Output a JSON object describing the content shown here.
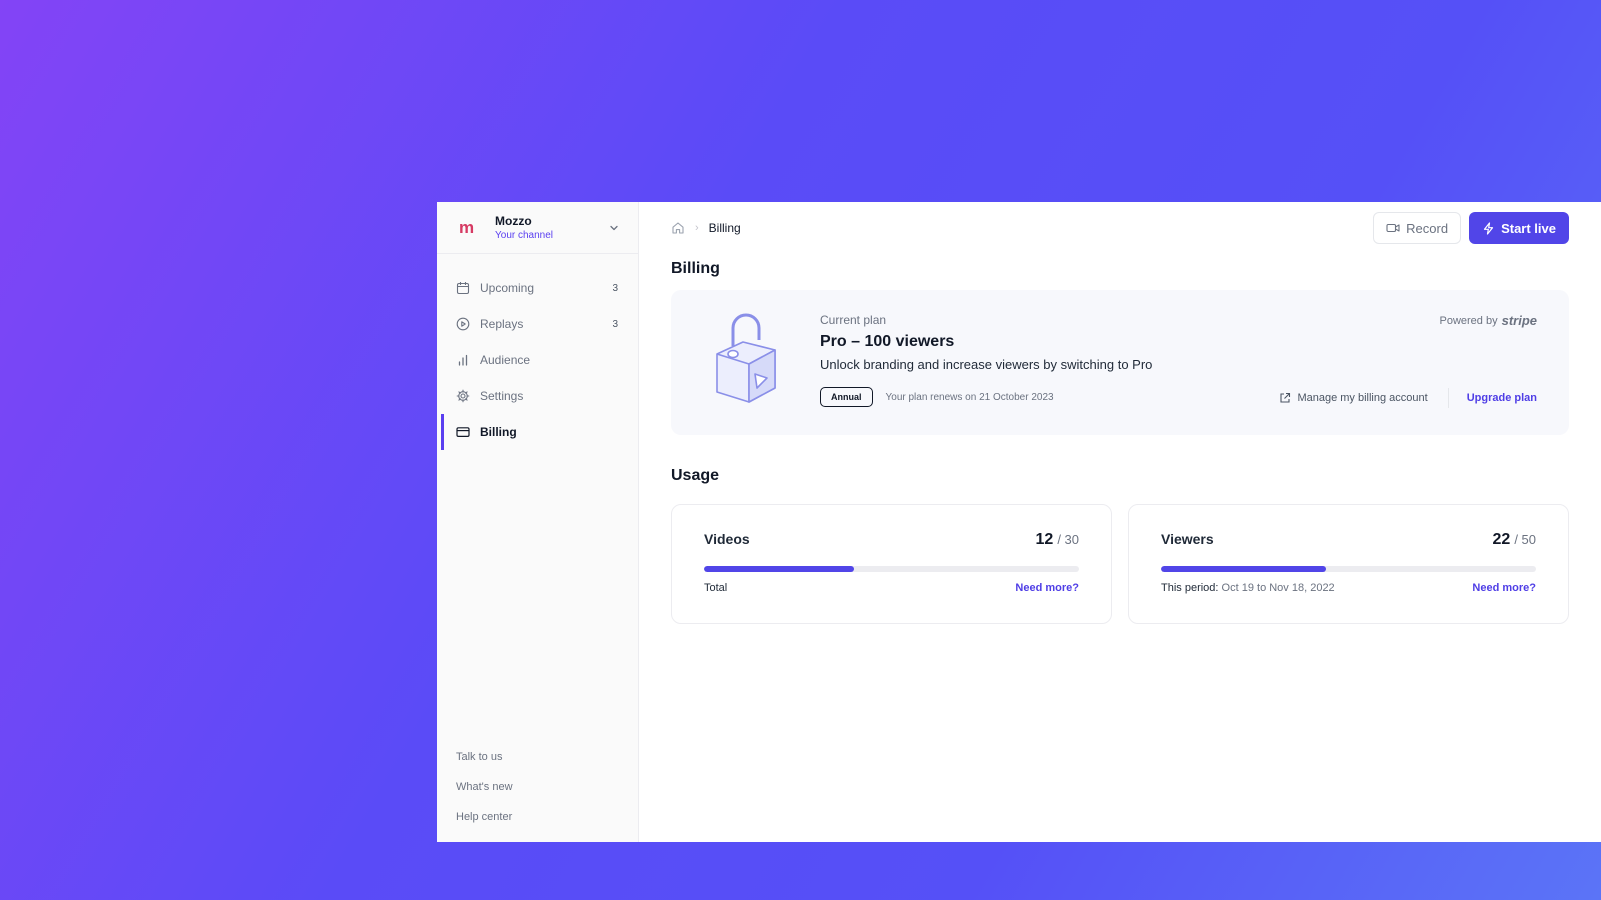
{
  "channel": {
    "logo": "m",
    "name": "Mozzo",
    "subtitle": "Your channel"
  },
  "sidebar": {
    "items": [
      {
        "icon": "calendar-icon",
        "label": "Upcoming",
        "count": "3"
      },
      {
        "icon": "play-circle-icon",
        "label": "Replays",
        "count": "3"
      },
      {
        "icon": "bar-chart-icon",
        "label": "Audience",
        "count": ""
      },
      {
        "icon": "gear-icon",
        "label": "Settings",
        "count": ""
      },
      {
        "icon": "credit-card-icon",
        "label": "Billing",
        "count": "",
        "active": true
      }
    ],
    "footer": [
      "Talk to us",
      "What's new",
      "Help center"
    ]
  },
  "breadcrumb": {
    "current": "Billing"
  },
  "toolbar": {
    "record_label": "Record",
    "start_live_label": "Start live"
  },
  "page_title": "Billing",
  "plan": {
    "label": "Current plan",
    "name": "Pro – 100 viewers",
    "description": "Unlock branding and increase viewers by switching to Pro",
    "badge": "Annual",
    "renewal": "Your plan renews on 21 October 2023",
    "powered_by": "Powered by",
    "provider": "stripe",
    "manage_label": "Manage my billing account",
    "upgrade_label": "Upgrade plan"
  },
  "usage": {
    "title": "Usage",
    "cards": [
      {
        "name": "Videos",
        "used": "12",
        "limit": "/ 30",
        "fill_fraction": 0.4,
        "foot_label": "Total",
        "foot_range": "",
        "more_label": "Need more?"
      },
      {
        "name": "Viewers",
        "used": "22",
        "limit": "/ 50",
        "fill_fraction": 0.44,
        "foot_label": "This period:",
        "foot_range": "Oct 19 to Nov 18, 2022",
        "more_label": "Need more?"
      }
    ]
  },
  "colors": {
    "accent": "#5145e8",
    "brand_logo": "#d63a63"
  }
}
